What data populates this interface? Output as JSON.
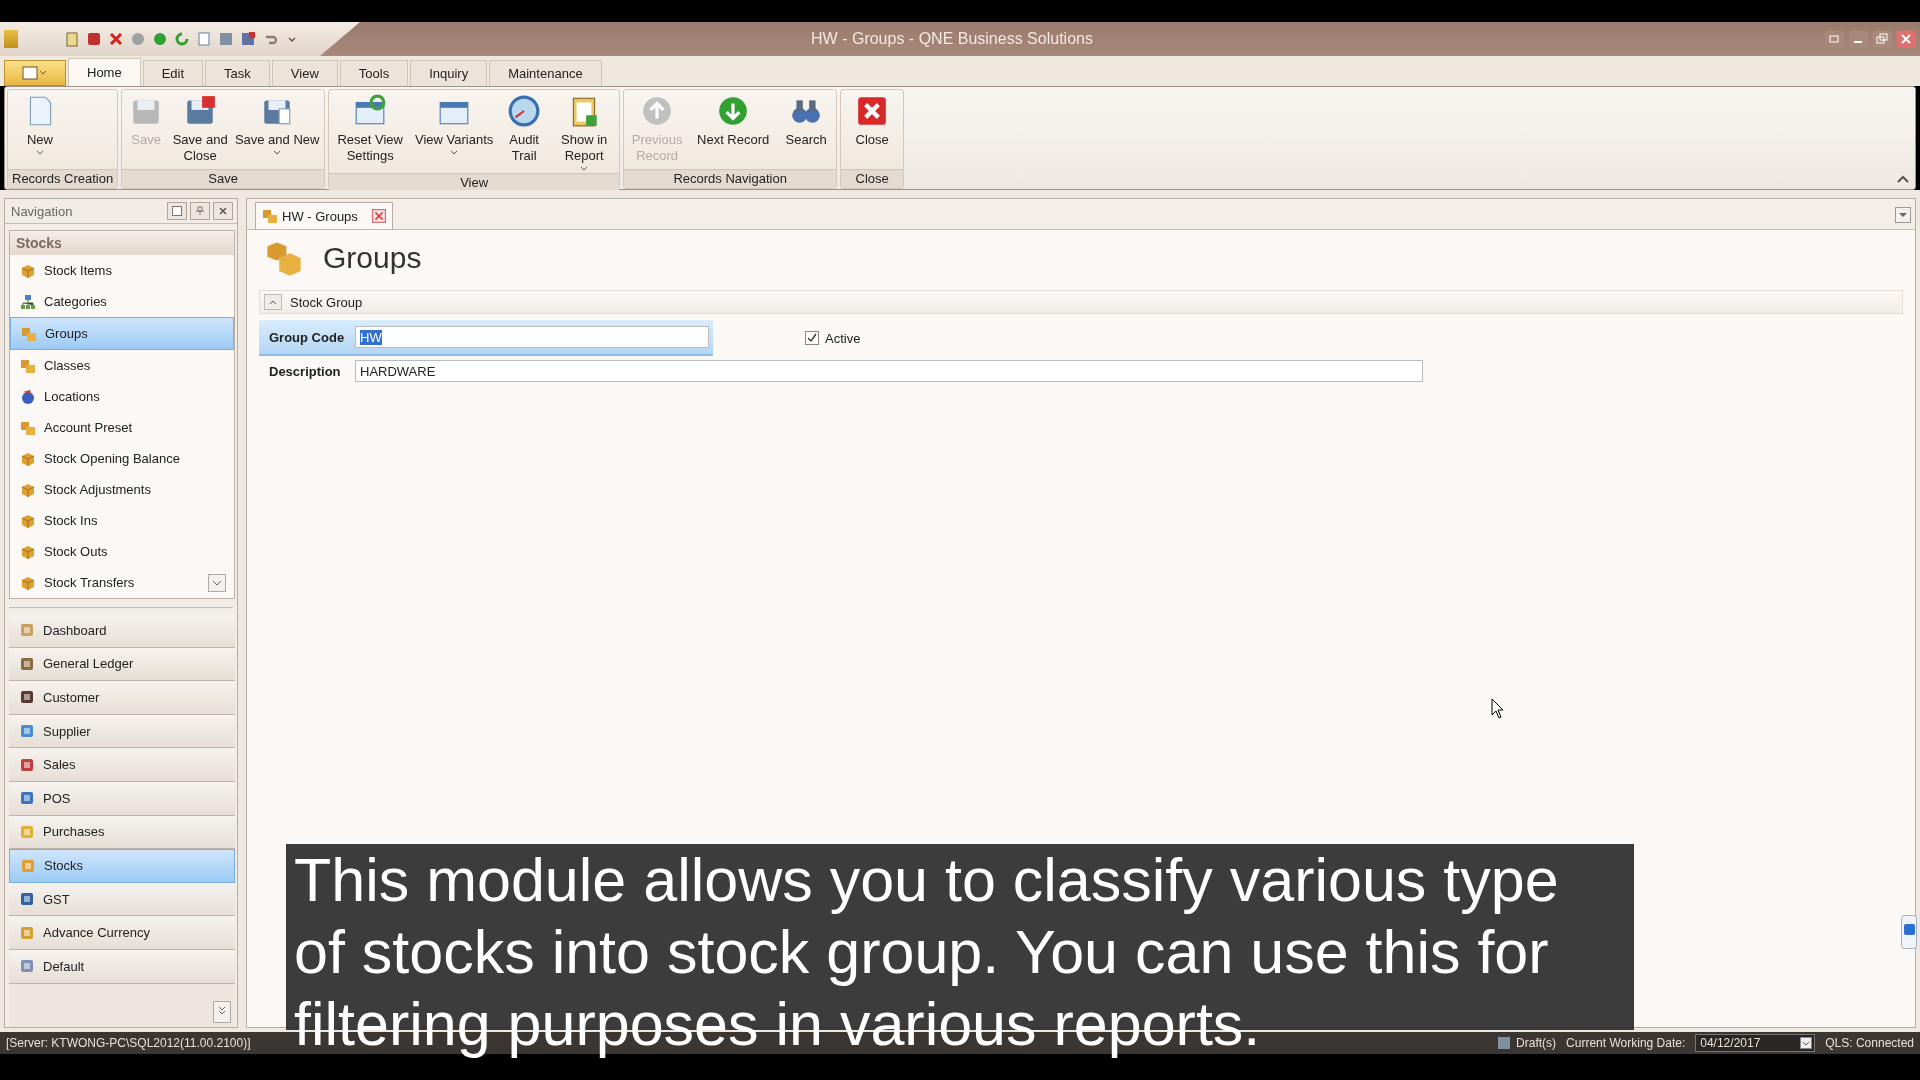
{
  "window": {
    "title": "HW - Groups - QNE Business Solutions"
  },
  "ribbon_tabs": [
    {
      "label": "Home",
      "selected": true
    },
    {
      "label": "Edit",
      "selected": false
    },
    {
      "label": "Task",
      "selected": false
    },
    {
      "label": "View",
      "selected": false
    },
    {
      "label": "Tools",
      "selected": false
    },
    {
      "label": "Inquiry",
      "selected": false
    },
    {
      "label": "Maintenance",
      "selected": false
    }
  ],
  "ribbon_groups": [
    {
      "label": "Records Creation",
      "buttons": [
        {
          "label": "New",
          "disabled": false,
          "menu": true
        }
      ]
    },
    {
      "label": "Save",
      "buttons": [
        {
          "label": "Save",
          "disabled": true,
          "menu": false
        },
        {
          "label": "Save and Close",
          "disabled": false,
          "menu": false
        },
        {
          "label": "Save and New",
          "disabled": false,
          "menu": true
        }
      ]
    },
    {
      "label": "View",
      "buttons": [
        {
          "label": "Reset View Settings",
          "disabled": false,
          "menu": false
        },
        {
          "label": "View Variants",
          "disabled": false,
          "menu": true
        },
        {
          "label": "Audit Trail",
          "disabled": false,
          "menu": false
        },
        {
          "label": "Show in Report",
          "disabled": false,
          "menu": true
        }
      ]
    },
    {
      "label": "Records Navigation",
      "buttons": [
        {
          "label": "Previous Record",
          "disabled": true,
          "menu": false
        },
        {
          "label": "Next Record",
          "disabled": false,
          "menu": false
        },
        {
          "label": "Search",
          "disabled": false,
          "menu": false
        }
      ]
    },
    {
      "label": "Close",
      "buttons": [
        {
          "label": "Close",
          "disabled": false,
          "menu": false
        }
      ]
    }
  ],
  "navigation": {
    "title": "Navigation",
    "group_title": "Stocks",
    "items": [
      {
        "label": "Stock Items",
        "selected": false
      },
      {
        "label": "Categories",
        "selected": false
      },
      {
        "label": "Groups",
        "selected": true
      },
      {
        "label": "Classes",
        "selected": false
      },
      {
        "label": "Locations",
        "selected": false
      },
      {
        "label": "Account Preset",
        "selected": false
      },
      {
        "label": "Stock Opening Balance",
        "selected": false
      },
      {
        "label": "Stock Adjustments",
        "selected": false
      },
      {
        "label": "Stock Ins",
        "selected": false
      },
      {
        "label": "Stock Outs",
        "selected": false
      },
      {
        "label": "Stock Transfers",
        "selected": false
      }
    ],
    "modules": [
      {
        "label": "Dashboard",
        "selected": false
      },
      {
        "label": "General Ledger",
        "selected": false
      },
      {
        "label": "Customer",
        "selected": false
      },
      {
        "label": "Supplier",
        "selected": false
      },
      {
        "label": "Sales",
        "selected": false
      },
      {
        "label": "POS",
        "selected": false
      },
      {
        "label": "Purchases",
        "selected": false
      },
      {
        "label": "Stocks",
        "selected": true
      },
      {
        "label": "GST",
        "selected": false
      },
      {
        "label": "Advance Currency",
        "selected": false
      },
      {
        "label": "Default",
        "selected": false
      }
    ]
  },
  "document_tab": {
    "label": "HW - Groups"
  },
  "form": {
    "heading": "Groups",
    "section": "Stock Group",
    "group_code": {
      "label": "Group Code",
      "value": "HW"
    },
    "active": {
      "label": "Active",
      "checked": true
    },
    "description": {
      "label": "Description",
      "value": "HARDWARE"
    }
  },
  "status_bar": {
    "server": "[Server: KTWONG-PC\\SQL2012(11.00.2100)]",
    "drafts": "Draft(s)",
    "date_label": "Current Working Date:",
    "date": "04/12/2017",
    "connection": "QLS: Connected"
  },
  "subtitle": "This module allows you to classify various type of stocks into stock group. You can use this for filtering purposes in various reports."
}
